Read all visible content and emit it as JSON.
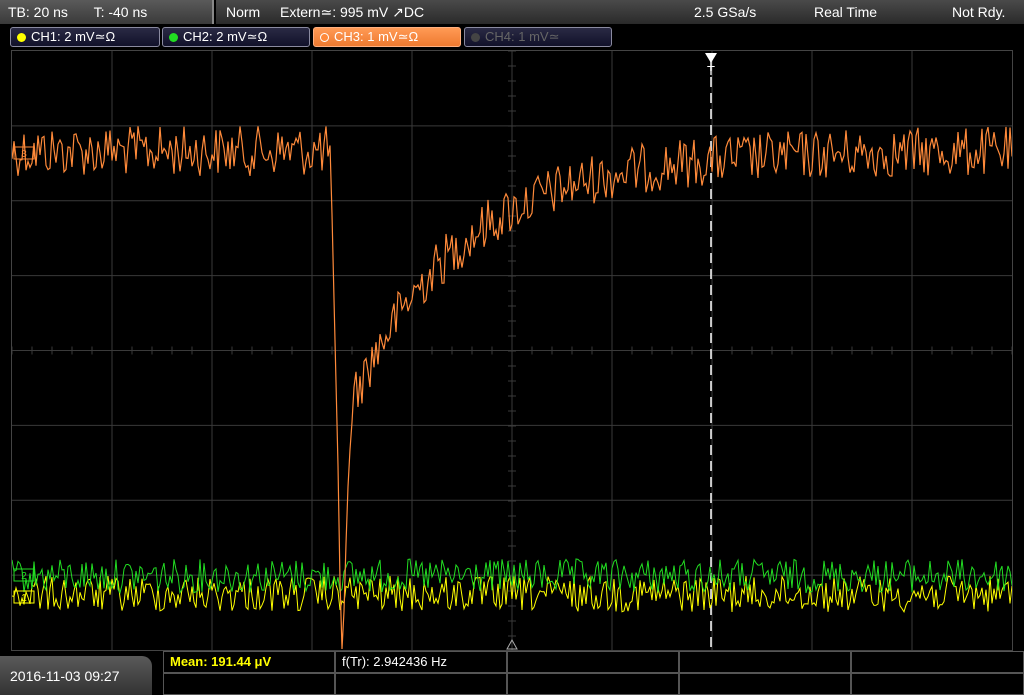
{
  "topbar": {
    "timebase": "TB: 20 ns",
    "trigger_offset": "T: -40 ns",
    "mode": "Norm",
    "trigger_source": "Extern≃: 995 mV ↗DC",
    "sample_rate": "2.5 GSa/s",
    "acq_mode": "Real Time",
    "status": "Not Rdy."
  },
  "channels": [
    {
      "label": "CH1: 2 mV≃Ω",
      "color": "#ffff00",
      "active": false
    },
    {
      "label": "CH2: 2 mV≃Ω",
      "color": "#22dd22",
      "active": false
    },
    {
      "label": "CH3: 1 mV≃Ω",
      "color": "#ff8a3a",
      "active": true
    },
    {
      "label": "CH4: 1 mV≃",
      "color": "#666666",
      "active": false
    }
  ],
  "markers": {
    "trigger_label": "T",
    "ch3_marker": "3",
    "ch2_marker": "2",
    "ch1_marker": "1"
  },
  "bottombar": {
    "datetime": "2016-11-03 09:27",
    "mean": "Mean: 191.44 μV",
    "freq": "f(Tr): 2.942436 Hz"
  },
  "colors": {
    "ch1": "#ffff00",
    "ch2": "#22dd22",
    "ch3": "#ff8a3a",
    "grid": "#3a3a3a"
  }
}
